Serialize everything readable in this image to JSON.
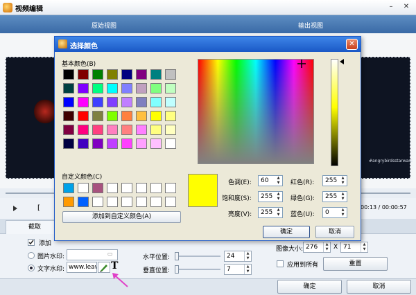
{
  "main_window": {
    "title": "视频编辑",
    "minimize": "–",
    "close": "✕",
    "view_original": "原始视图",
    "view_output": "输出视图",
    "video_watermark": "#angrybirdsstarwars",
    "mark_button": "[",
    "time": "00:13 / 00:00:57",
    "tab_crop": "截取"
  },
  "panel": {
    "add_watermark_label": "添加",
    "image_watermark_label": "图片水印:",
    "text_watermark_label": "文字水印:",
    "text_watermark_value": "www.leaw",
    "horizontal_position_label": "水平位置:",
    "horizontal_position_value": "24",
    "horizontal_position_level": 0.0,
    "vertical_position_label": "垂直位置:",
    "vertical_position_value": "7",
    "vertical_position_level": 0.0,
    "image_size_label": "图像大小:",
    "image_width_value": "276",
    "size_separator": "X",
    "image_height_value": "71",
    "apply_all_label": "应用到所有",
    "reset_button": "重置",
    "font_icon_glyph": "T"
  },
  "bottom": {
    "ok_button": "确定",
    "cancel_button": "取消"
  },
  "color_dialog": {
    "title": "选择颜色",
    "basic_colors_label": "基本颜色(B)",
    "basic_colors": [
      "#000000",
      "#800000",
      "#008000",
      "#808000",
      "#000080",
      "#800080",
      "#008080",
      "#c0c0c0",
      "#004040",
      "#8000ff",
      "#00ff80",
      "#00ffff",
      "#8080ff",
      "#c0a0c0",
      "#80ff80",
      "#c0ffc0",
      "#0000ff",
      "#ff00ff",
      "#4040ff",
      "#8040ff",
      "#c080ff",
      "#8080c0",
      "#80ffff",
      "#c0ffff",
      "#400000",
      "#ff0000",
      "#808040",
      "#80ff00",
      "#ff8040",
      "#ffc040",
      "#ffff00",
      "#ffff80",
      "#800040",
      "#ff0080",
      "#ff4080",
      "#ff80c0",
      "#ff8080",
      "#ff80ff",
      "#ffff80",
      "#ffffc0",
      "#000040",
      "#4000c0",
      "#8000c0",
      "#c040ff",
      "#ff40ff",
      "#ffa0ff",
      "#ffc0ff",
      "#ffffff"
    ],
    "custom_colors_label": "自定义颜色(C)",
    "custom_colors": [
      "#00a2e8",
      "#ffffff",
      "#a8527e",
      "#ffffff",
      "#ffffff",
      "#ffffff",
      "#ffffff",
      "#ffffff",
      "#ff9a00",
      "#0060ff",
      "#ffffff",
      "#ffffff",
      "#ffffff",
      "#ffffff",
      "#ffffff",
      "#ffffff"
    ],
    "add_custom_button": "添加到自定义颜色(A)",
    "hue_label": "色调(E):",
    "hue_value": "60",
    "saturation_label": "饱和度(S):",
    "saturation_value": "255",
    "luminance_label": "亮度(V):",
    "luminance_value": "255",
    "red_label": "红色(R):",
    "red_value": "255",
    "green_label": "绿色(G):",
    "green_value": "255",
    "blue_label": "蓝色(U):",
    "blue_value": "0",
    "ok_button": "确定",
    "cancel_button": "取消",
    "preview_color": "#ffff00"
  },
  "colors": {
    "title_blue": "#1a58c6",
    "annotation_pink": "#e040c8"
  }
}
